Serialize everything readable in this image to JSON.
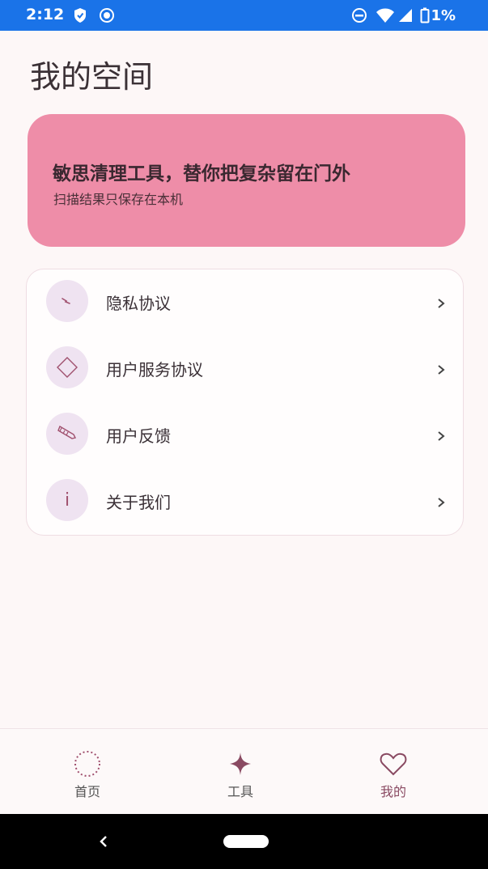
{
  "status_bar": {
    "time": "2:12",
    "battery": "1%",
    "icons": [
      "shield-icon",
      "record-icon",
      "dnd-icon",
      "wifi-icon",
      "signal-icon",
      "battery-icon"
    ]
  },
  "page": {
    "title": "我的空间"
  },
  "hero": {
    "title": "敏思清理工具，替你把复杂留在门外",
    "subtitle": "扫描结果只保存在本机",
    "color": "#ee8da8"
  },
  "menu": {
    "items": [
      {
        "label": "隐私协议",
        "icon": "lightning-icon"
      },
      {
        "label": "用户服务协议",
        "icon": "diamond-icon"
      },
      {
        "label": "用户反馈",
        "icon": "pencil-icon"
      },
      {
        "label": "关于我们",
        "icon": "info-icon"
      }
    ]
  },
  "bottom_nav": {
    "items": [
      {
        "label": "首页",
        "icon": "dotted-circle-icon",
        "active": false
      },
      {
        "label": "工具",
        "icon": "sparkle-icon",
        "active": false
      },
      {
        "label": "我的",
        "icon": "heart-icon",
        "active": true
      }
    ]
  },
  "colors": {
    "accent": "#8a4a62",
    "status_bar": "#1a73e8"
  }
}
